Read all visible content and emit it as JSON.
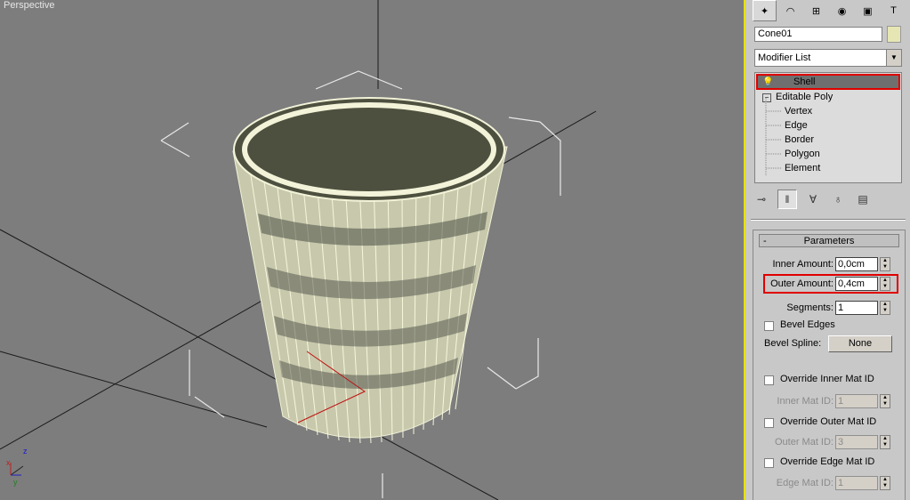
{
  "viewport": {
    "label": "Perspective"
  },
  "panel": {
    "tabs": [
      {
        "icon": "create-icon",
        "active": true
      },
      {
        "icon": "modify-icon",
        "active": false
      },
      {
        "icon": "hierarchy-icon",
        "active": false
      },
      {
        "icon": "motion-icon",
        "active": false
      },
      {
        "icon": "display-icon",
        "active": false
      },
      {
        "icon": "utilities-icon",
        "active": false
      }
    ],
    "object_name": "Cone01",
    "modifier_list": "Modifier List",
    "stack": {
      "shell": "Shell",
      "editable_poly": "Editable Poly",
      "subobjects": [
        "Vertex",
        "Edge",
        "Border",
        "Polygon",
        "Element"
      ]
    },
    "parameters": {
      "title": "Parameters",
      "inner_amount_label": "Inner Amount:",
      "inner_amount": "0,0cm",
      "outer_amount_label": "Outer Amount:",
      "outer_amount": "0,4cm",
      "segments_label": "Segments:",
      "segments": "1",
      "bevel_edges_label": "Bevel Edges",
      "bevel_spline_label": "Bevel Spline:",
      "bevel_spline_value": "None",
      "override_inner_label": "Override Inner Mat ID",
      "inner_mat_id_label": "Inner Mat ID:",
      "inner_mat_id": "1",
      "override_outer_label": "Override Outer Mat ID",
      "outer_mat_id_label": "Outer Mat ID:",
      "outer_mat_id": "3",
      "override_edge_label": "Override Edge Mat ID",
      "edge_mat_id_label": "Edge Mat ID:",
      "edge_mat_id": "1"
    }
  },
  "axis": {
    "x": "x",
    "y": "y",
    "z": "z"
  },
  "colors": {
    "viewport_bg": "#7d7d7d",
    "highlight": "#e00000",
    "mesh": "#e9ebc6"
  }
}
